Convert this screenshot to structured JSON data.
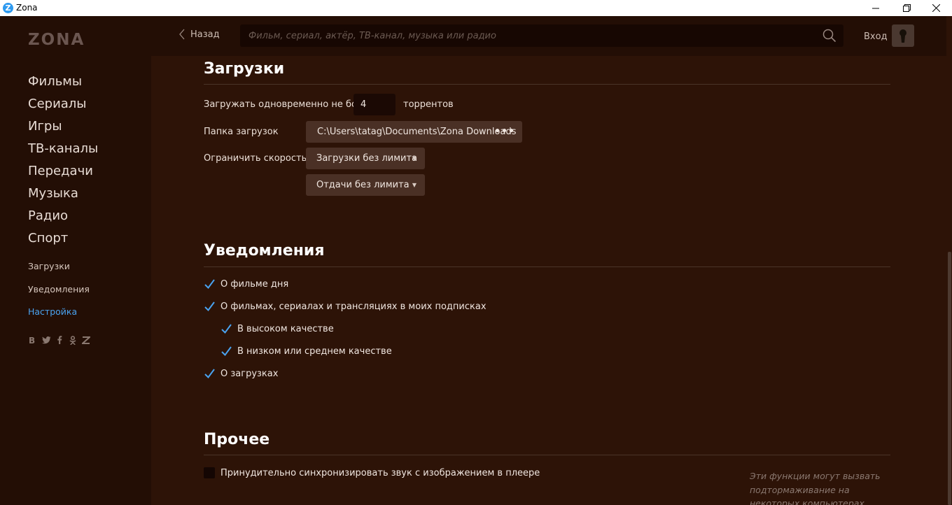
{
  "window": {
    "title": "Zona",
    "app_icon_letter": "Z"
  },
  "sidebar": {
    "logo": "ZONA",
    "main_items": [
      {
        "label": "Фильмы"
      },
      {
        "label": "Сериалы"
      },
      {
        "label": "Игры"
      },
      {
        "label": "ТВ-каналы"
      },
      {
        "label": "Передачи"
      },
      {
        "label": "Музыка"
      },
      {
        "label": "Радио"
      },
      {
        "label": "Спорт"
      }
    ],
    "small_items": [
      {
        "label": "Загрузки"
      },
      {
        "label": "Уведомления"
      },
      {
        "label": "Настройка",
        "active": true
      }
    ],
    "social_icons": [
      "vk-icon",
      "twitter-icon",
      "facebook-icon",
      "odnoklassniki-icon",
      "zona-icon"
    ],
    "active_color": "#4aa3f0"
  },
  "header": {
    "back_label": "Назад",
    "search_placeholder": "Фильм, сериал, актёр, ТВ-канал, музыка или радио",
    "login_label": "Вход"
  },
  "downloads": {
    "title": "Загрузки",
    "concurrent_prefix": "Загружать одновременно не более",
    "concurrent_value": "4",
    "concurrent_suffix": "торрентов",
    "folder_label": "Папка загрузок",
    "folder_path": "C:\\Users\\tatag\\Documents\\Zona Downloads",
    "folder_more": "•••",
    "speed_label": "Ограничить скорость",
    "download_limit": "Загрузки без лимита",
    "upload_limit": "Отдачи без лимита"
  },
  "notifications": {
    "title": "Уведомления",
    "options": [
      {
        "label": "О фильме дня",
        "checked": true
      },
      {
        "label": "О фильмах, сериалах и трансляциях в моих подписках",
        "checked": true
      },
      {
        "label": "В высоком качестве",
        "checked": true
      },
      {
        "label": "В низком или среднем качестве",
        "checked": true
      },
      {
        "label": "О загрузках",
        "checked": true
      }
    ]
  },
  "other": {
    "title": "Прочее",
    "sync_label": "Принудительно синхронизировать звук с изображением в плеере",
    "sync_checked": false,
    "note_lines": [
      "Эти функции могут вызвать",
      "подтормаживание на",
      "некоторых компьютерах"
    ]
  },
  "colors": {
    "background": "#2d1307",
    "sidebar": "#230e05",
    "check": "#4aa3f0"
  }
}
